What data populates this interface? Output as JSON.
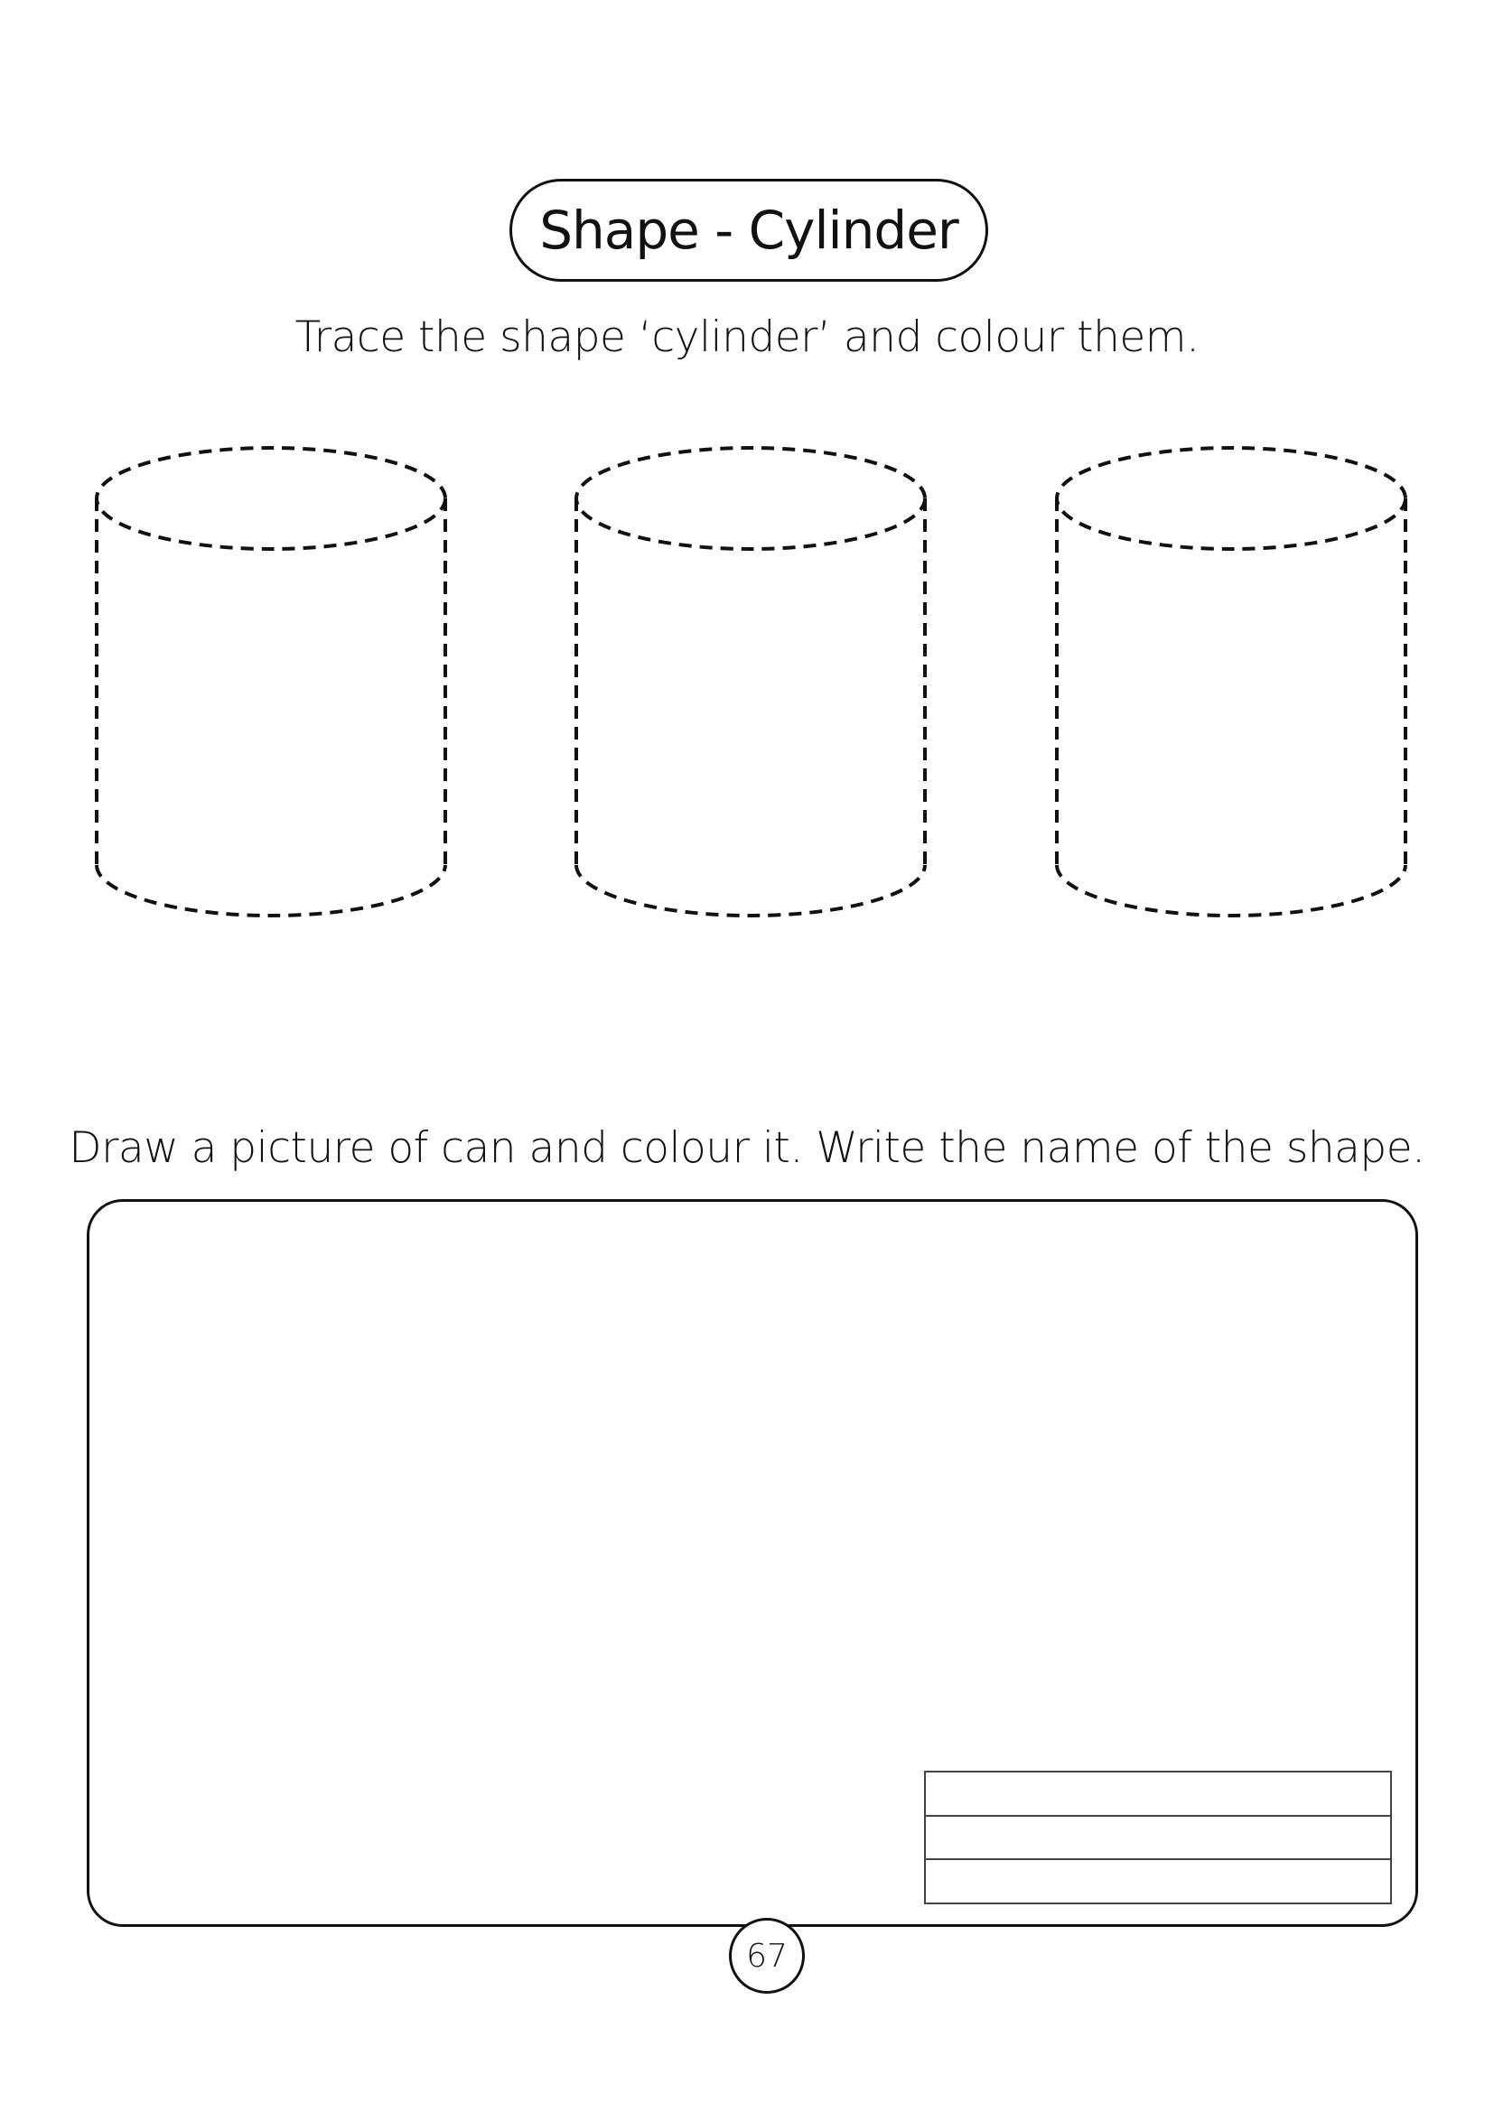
{
  "title": "Shape - Cylinder",
  "instruction_trace": "Trace the shape ‘cylinder’ and colour them.",
  "instruction_draw": "Draw a picture of can and colour it. Write the name of the shape.",
  "cylinders_count": 3,
  "answer_lines_count": 3,
  "page_number": "67",
  "colors": {
    "ink": "#111111",
    "background": "#ffffff"
  }
}
